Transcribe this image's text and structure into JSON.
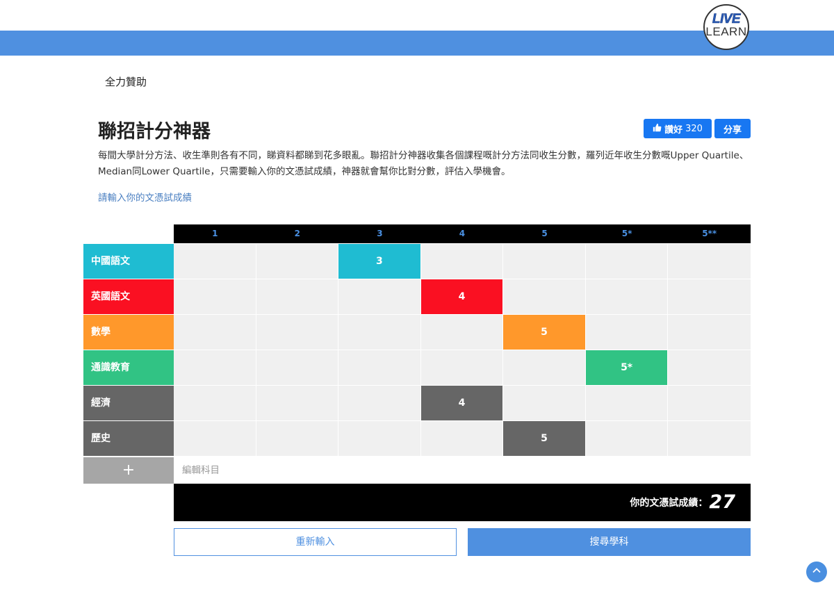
{
  "logo": {
    "line1": "LIVE",
    "line2": "LEARN"
  },
  "sponsor": "全力贊助",
  "title": "聯招計分神器",
  "facebook": {
    "like_label": "讚好",
    "like_count": "320",
    "share_label": "分享"
  },
  "description": "每間大學計分方法、收生準則各有不同，睇資料都睇到花多眼亂。聯招計分神器收集各個課程嘅計分方法同收生分數，羅列近年收生分數嘅Upper Quartile、Median同Lower Quartile，只需要輸入你的文憑試成績，神器就會幫你比對分數，評估入學機會。",
  "prompt": "請輸入你的文憑試成績",
  "grades": [
    "1",
    "2",
    "3",
    "4",
    "5",
    "5*",
    "5**"
  ],
  "subjects": [
    {
      "name": "中國語文",
      "selected": "3",
      "color": "#1fbcd2"
    },
    {
      "name": "英國語文",
      "selected": "4",
      "color": "#fa1022"
    },
    {
      "name": "數學",
      "selected": "5",
      "color": "#ff982b"
    },
    {
      "name": "通識教育",
      "selected": "5*",
      "color": "#31c384"
    },
    {
      "name": "經濟",
      "selected": "4",
      "color": "#666666"
    },
    {
      "name": "歷史",
      "selected": "5",
      "color": "#666666"
    }
  ],
  "add_subject": {
    "icon": "plus-icon",
    "label": "+",
    "edit_label": "編輯科目"
  },
  "score": {
    "label": "你的文憑試成績：",
    "value": "27"
  },
  "buttons": {
    "reset": "重新輸入",
    "search": "搜尋學科"
  },
  "scroll_top_icon": "chevron-up-icon"
}
